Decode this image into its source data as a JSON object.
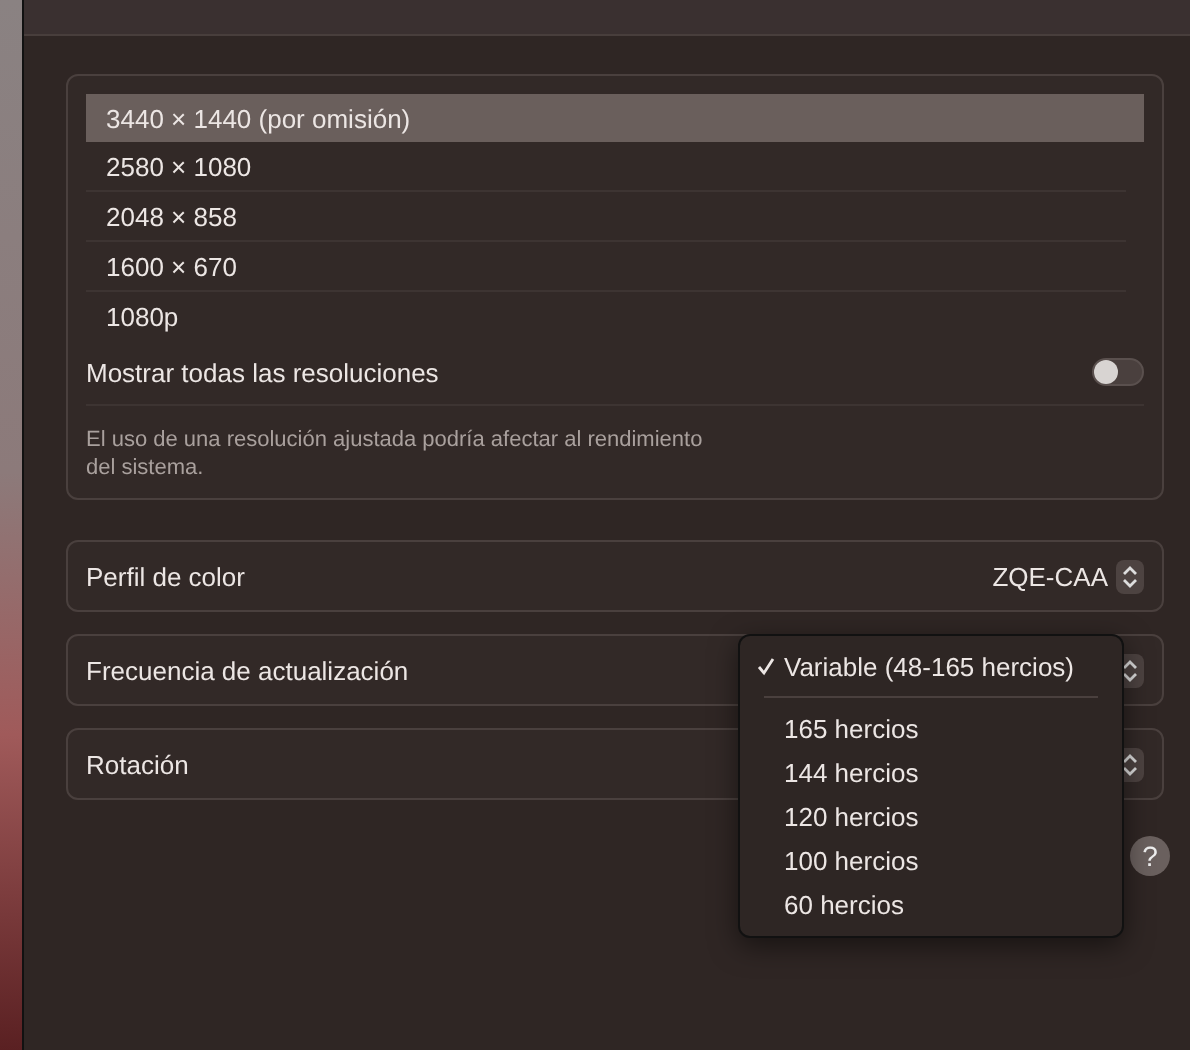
{
  "resolutions": [
    {
      "label": "3440 × 1440 (por omisión)",
      "selected": true
    },
    {
      "label": "2580 × 1080",
      "selected": false
    },
    {
      "label": "2048 × 858",
      "selected": false
    },
    {
      "label": "1600 × 670",
      "selected": false
    },
    {
      "label": "1080p",
      "selected": false
    }
  ],
  "show_all": {
    "label": "Mostrar todas las resoluciones",
    "on": false
  },
  "note": "El uso de una resolución ajustada podría afectar al rendimiento del sistema.",
  "settings": [
    {
      "label": "Perfil de color",
      "value": "ZQE-CAA"
    },
    {
      "label": "Frecuencia de actualización"
    },
    {
      "label": "Rotación"
    }
  ],
  "refresh_menu": {
    "options": [
      {
        "label": "Variable (48-165 hercios)",
        "checked": true
      },
      {
        "label": "165 hercios",
        "checked": false
      },
      {
        "label": "144 hercios",
        "checked": false
      },
      {
        "label": "120 hercios",
        "checked": false
      },
      {
        "label": "100 hercios",
        "checked": false
      },
      {
        "label": "60 hercios",
        "checked": false
      }
    ]
  },
  "help": "?"
}
